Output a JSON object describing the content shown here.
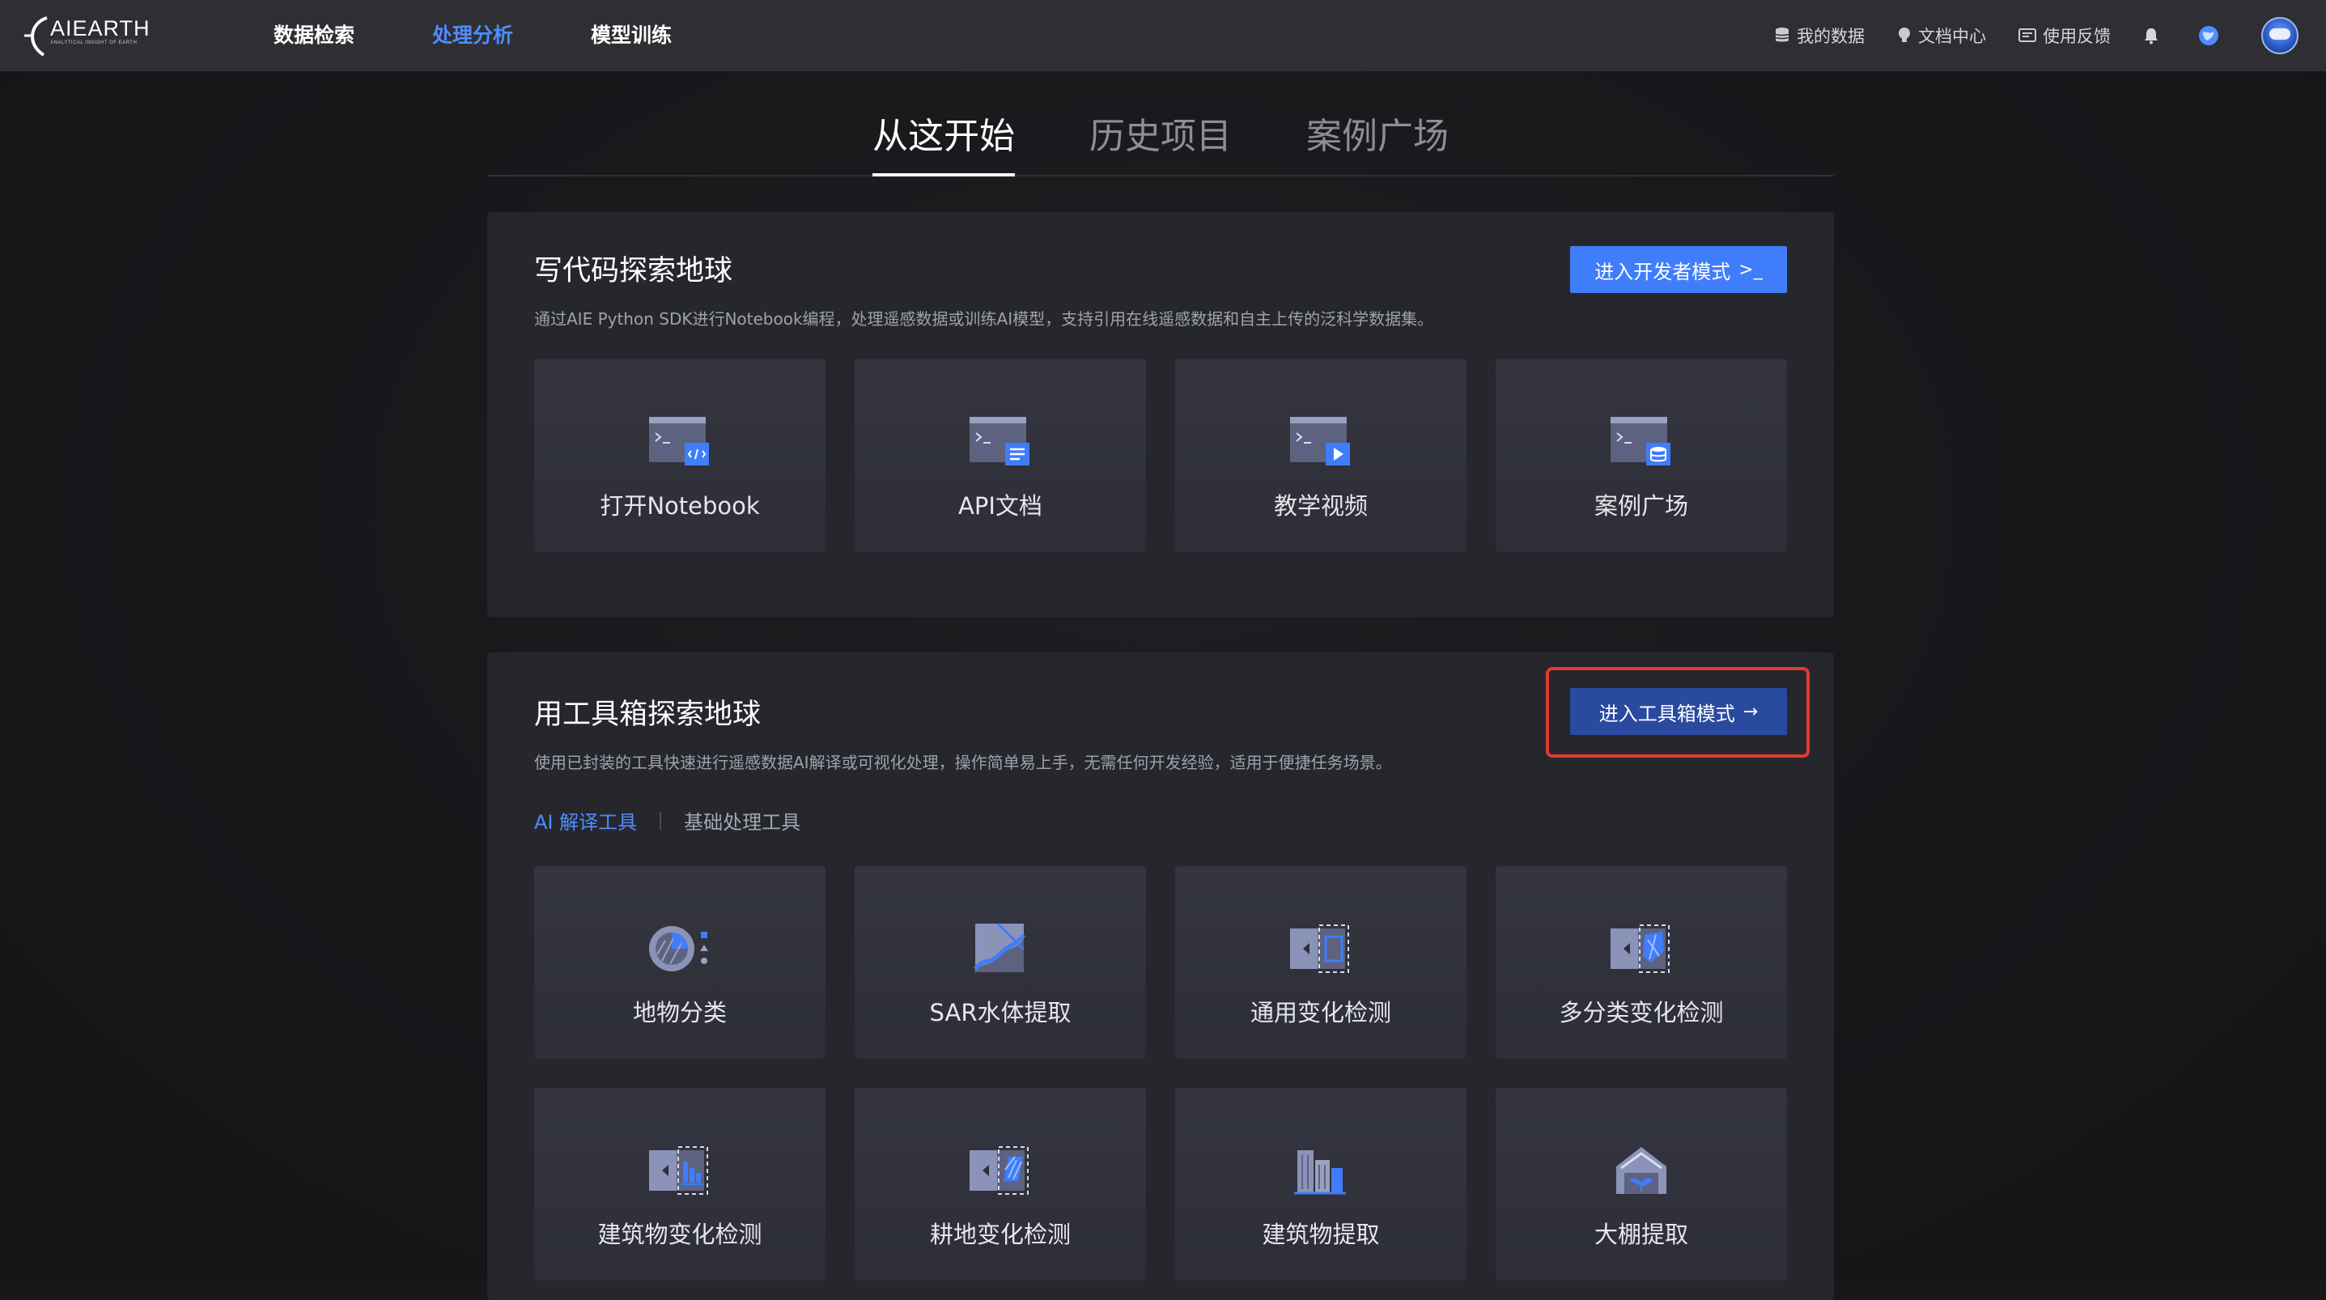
{
  "app": {
    "logo_text": "AIEARTH",
    "logo_subtitle": "ANALYTICAL INSIGHT OF EARTH"
  },
  "nav": {
    "items": [
      {
        "label": "数据检索",
        "active": false
      },
      {
        "label": "处理分析",
        "active": true
      },
      {
        "label": "模型训练",
        "active": false
      }
    ]
  },
  "top_right": {
    "my_data": "我的数据",
    "docs": "文档中心",
    "feedback": "使用反馈"
  },
  "main_tabs": [
    {
      "label": "从这开始",
      "active": true
    },
    {
      "label": "历史项目",
      "active": false
    },
    {
      "label": "案例广场",
      "active": false
    }
  ],
  "code_panel": {
    "title": "写代码探索地球",
    "description": "通过AIE Python SDK进行Notebook编程，处理遥感数据或训练AI模型，支持引用在线遥感数据和自主上传的泛科学数据集。",
    "button_label": "进入开发者模式",
    "button_icon": ">_",
    "cards": [
      {
        "label": "打开Notebook",
        "icon": "notebook-code-icon"
      },
      {
        "label": "API文档",
        "icon": "api-doc-icon"
      },
      {
        "label": "教学视频",
        "icon": "video-icon"
      },
      {
        "label": "案例广场",
        "icon": "case-plaza-icon"
      }
    ]
  },
  "tool_panel": {
    "title": "用工具箱探索地球",
    "description": "使用已封装的工具快速进行遥感数据AI解译或可视化处理，操作简单易上手，无需任何开发经验，适用于便捷任务场景。",
    "button_label": "进入工具箱模式",
    "button_icon": "→",
    "sub_tabs": [
      {
        "label": "AI 解译工具",
        "active": true
      },
      {
        "label": "基础处理工具",
        "active": false
      }
    ],
    "cards": [
      {
        "label": "地物分类",
        "icon": "land-classification-icon"
      },
      {
        "label": "SAR水体提取",
        "icon": "sar-water-icon"
      },
      {
        "label": "通用变化检测",
        "icon": "change-detection-icon"
      },
      {
        "label": "多分类变化检测",
        "icon": "multi-class-change-icon"
      },
      {
        "label": "建筑物变化检测",
        "icon": "building-change-icon"
      },
      {
        "label": "耕地变化检测",
        "icon": "farmland-change-icon"
      },
      {
        "label": "建筑物提取",
        "icon": "building-extract-icon"
      },
      {
        "label": "大棚提取",
        "icon": "greenhouse-icon"
      }
    ]
  },
  "colors": {
    "accent": "#4d8dff",
    "primary_button": "#3f7dfa",
    "tool_button": "#2a4aa0",
    "highlight": "#e33a2e",
    "topbar": "#2e2e33",
    "panel": "#26272d"
  }
}
